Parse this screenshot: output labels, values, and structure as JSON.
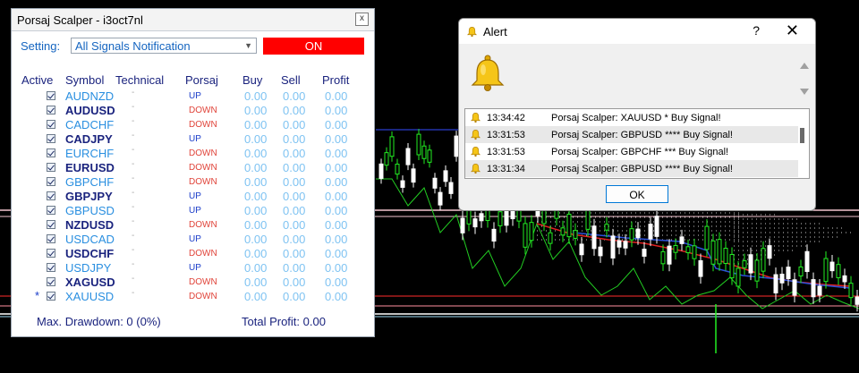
{
  "scalper": {
    "title": "Porsaj Scalper - i3oct7nl",
    "close_label": "x",
    "setting_label": "Setting:",
    "setting_value": "All Signals Notification",
    "on_label": "ON",
    "headers": {
      "active": "Active",
      "symbol": "Symbol",
      "technical": "Technical",
      "porsaj": "Porsaj",
      "buy": "Buy",
      "sell": "Sell",
      "profit": "Profit"
    },
    "rows": [
      {
        "symbol": "AUDNZD",
        "tech": "-",
        "dir": "UP",
        "buy": "0.00",
        "sell": "0.00",
        "profit": "0.00"
      },
      {
        "symbol": "AUDUSD",
        "tech": "-",
        "dir": "DOWN",
        "buy": "0.00",
        "sell": "0.00",
        "profit": "0.00"
      },
      {
        "symbol": "CADCHF",
        "tech": "-",
        "dir": "DOWN",
        "buy": "0.00",
        "sell": "0.00",
        "profit": "0.00"
      },
      {
        "symbol": "CADJPY",
        "tech": "-",
        "dir": "UP",
        "buy": "0.00",
        "sell": "0.00",
        "profit": "0.00"
      },
      {
        "symbol": "EURCHF",
        "tech": "-",
        "dir": "DOWN",
        "buy": "0.00",
        "sell": "0.00",
        "profit": "0.00"
      },
      {
        "symbol": "EURUSD",
        "tech": "-",
        "dir": "DOWN",
        "buy": "0.00",
        "sell": "0.00",
        "profit": "0.00"
      },
      {
        "symbol": "GBPCHF",
        "tech": "-",
        "dir": "DOWN",
        "buy": "0.00",
        "sell": "0.00",
        "profit": "0.00"
      },
      {
        "symbol": "GBPJPY",
        "tech": "-",
        "dir": "UP",
        "buy": "0.00",
        "sell": "0.00",
        "profit": "0.00"
      },
      {
        "symbol": "GBPUSD",
        "tech": "-",
        "dir": "UP",
        "buy": "0.00",
        "sell": "0.00",
        "profit": "0.00"
      },
      {
        "symbol": "NZDUSD",
        "tech": "-",
        "dir": "DOWN",
        "buy": "0.00",
        "sell": "0.00",
        "profit": "0.00"
      },
      {
        "symbol": "USDCAD",
        "tech": "-",
        "dir": "UP",
        "buy": "0.00",
        "sell": "0.00",
        "profit": "0.00"
      },
      {
        "symbol": "USDCHF",
        "tech": "-",
        "dir": "DOWN",
        "buy": "0.00",
        "sell": "0.00",
        "profit": "0.00"
      },
      {
        "symbol": "USDJPY",
        "tech": "-",
        "dir": "UP",
        "buy": "0.00",
        "sell": "0.00",
        "profit": "0.00"
      },
      {
        "symbol": "XAGUSD",
        "tech": "-",
        "dir": "DOWN",
        "buy": "0.00",
        "sell": "0.00",
        "profit": "0.00"
      },
      {
        "symbol": "XAUUSD",
        "tech": "-",
        "dir": "DOWN",
        "buy": "0.00",
        "sell": "0.00",
        "profit": "0.00",
        "marker": "*"
      }
    ],
    "max_drawdown": "Max. Drawdown: 0 (0%)",
    "total_profit": "Total Profit: 0.00"
  },
  "alert": {
    "title": "Alert",
    "help_label": "?",
    "close_label": "✕",
    "log": [
      {
        "time": "13:34:42",
        "message": "Porsaj Scalper: XAUUSD * Buy Signal!"
      },
      {
        "time": "13:31:53",
        "message": "Porsaj Scalper: GBPUSD **** Buy Signal!"
      },
      {
        "time": "13:31:53",
        "message": "Porsaj Scalper: GBPCHF *** Buy Signal!"
      },
      {
        "time": "13:31:34",
        "message": "Porsaj Scalper: GBPUSD **** Buy Signal!"
      }
    ],
    "ok_label": "OK"
  },
  "colors": {
    "on_button": "#ff0000",
    "up": "#1a3cc9",
    "down": "#e0443a",
    "value": "#7fc3f2"
  }
}
